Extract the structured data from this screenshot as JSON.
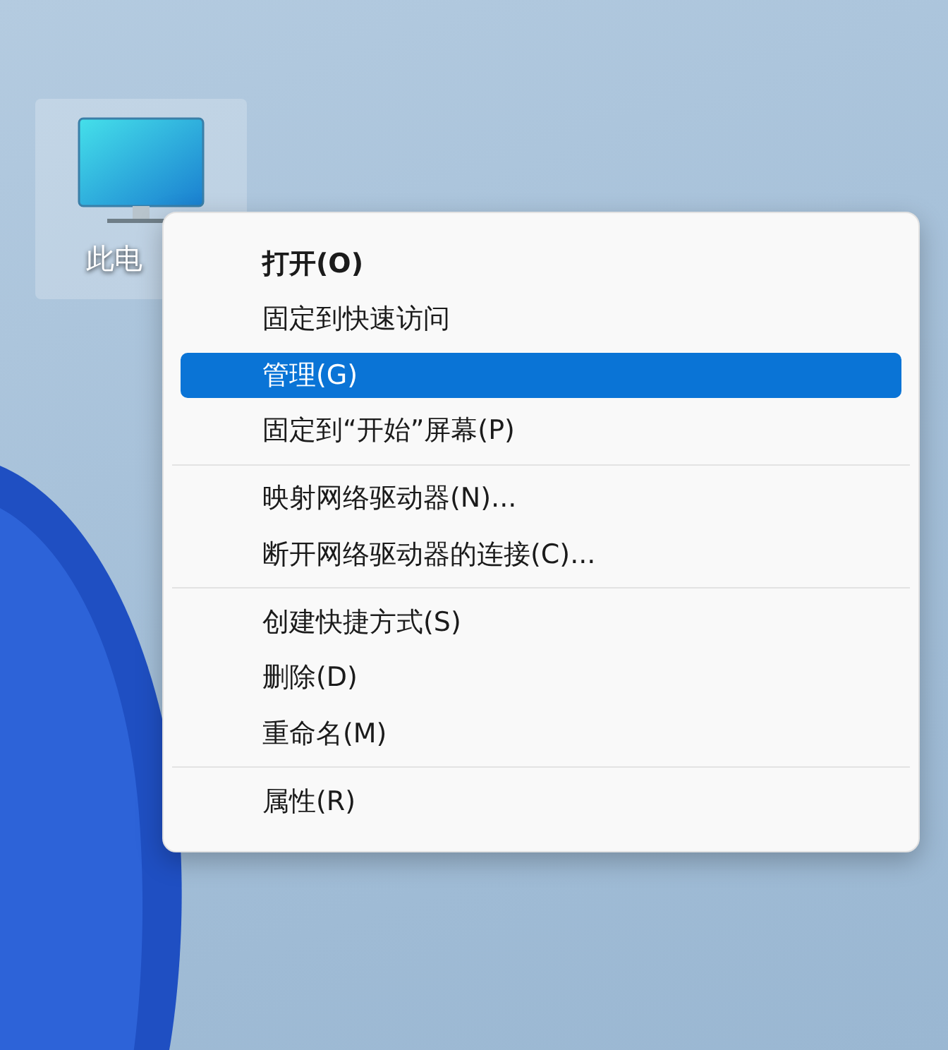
{
  "desktop_icon": {
    "label": "此电",
    "selected": true
  },
  "context_menu": {
    "groups": [
      [
        {
          "label": "打开(O)",
          "default": true,
          "selected": false
        },
        {
          "label": "固定到快速访问",
          "default": false,
          "selected": false
        },
        {
          "label": "管理(G)",
          "default": false,
          "selected": true
        },
        {
          "label": "固定到“开始”屏幕(P)",
          "default": false,
          "selected": false
        }
      ],
      [
        {
          "label": "映射网络驱动器(N)...",
          "default": false,
          "selected": false
        },
        {
          "label": "断开网络驱动器的连接(C)...",
          "default": false,
          "selected": false
        }
      ],
      [
        {
          "label": "创建快捷方式(S)",
          "default": false,
          "selected": false
        },
        {
          "label": "删除(D)",
          "default": false,
          "selected": false
        },
        {
          "label": "重命名(M)",
          "default": false,
          "selected": false
        }
      ],
      [
        {
          "label": "属性(R)",
          "default": false,
          "selected": false
        }
      ]
    ]
  }
}
